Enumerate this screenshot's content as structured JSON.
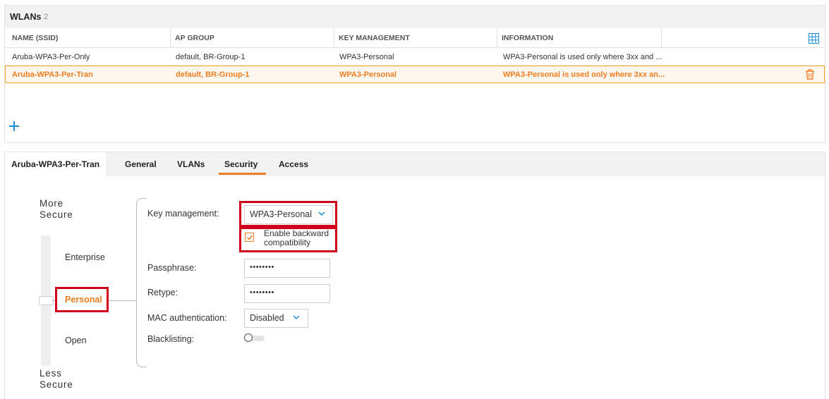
{
  "wlans": {
    "title": "WLANs",
    "count": "2",
    "columns": [
      "NAME (SSID)",
      "AP GROUP",
      "KEY MANAGEMENT",
      "INFORMATION"
    ],
    "rows": [
      {
        "name": "Aruba-WPA3-Per-Only",
        "ap_group": "default, BR-Group-1",
        "key_management": "WPA3-Personal",
        "information": "WPA3-Personal is used only where 3xx and ..."
      },
      {
        "name": "Aruba-WPA3-Per-Tran",
        "ap_group": "default, BR-Group-1",
        "key_management": "WPA3-Personal",
        "information": "WPA3-Personal is used only where 3xx an..."
      }
    ],
    "selected_row": 1,
    "icons": {
      "columns": "grid-icon",
      "delete": "trash-icon",
      "add": "plus-icon"
    }
  },
  "detail": {
    "name_tab": "Aruba-WPA3-Per-Tran",
    "tabs": [
      "General",
      "VLANs",
      "Security",
      "Access"
    ],
    "active_tab": "Security"
  },
  "security": {
    "more_secure_1": "More",
    "more_secure_2": "Secure",
    "less_secure_1": "Less",
    "less_secure_2": "Secure",
    "levels": [
      "Enterprise",
      "Personal",
      "Open"
    ],
    "selected_level": "Personal",
    "key_management_label": "Key management:",
    "key_management_value": "WPA3-Personal",
    "backward_compat_line1": "Enable backward",
    "backward_compat_line2": "compatibility",
    "backward_compat_checked": true,
    "passphrase_label": "Passphrase:",
    "passphrase_value": "••••••••",
    "retype_label": "Retype:",
    "retype_value": "••••••••",
    "mac_auth_label": "MAC authentication:",
    "mac_auth_value": "Disabled",
    "blacklisting_label": "Blacklisting:",
    "blacklisting_on": false
  },
  "colors": {
    "accent": "#ef7d22",
    "highlight": "#d0021b",
    "link": "#1a8fd6"
  }
}
